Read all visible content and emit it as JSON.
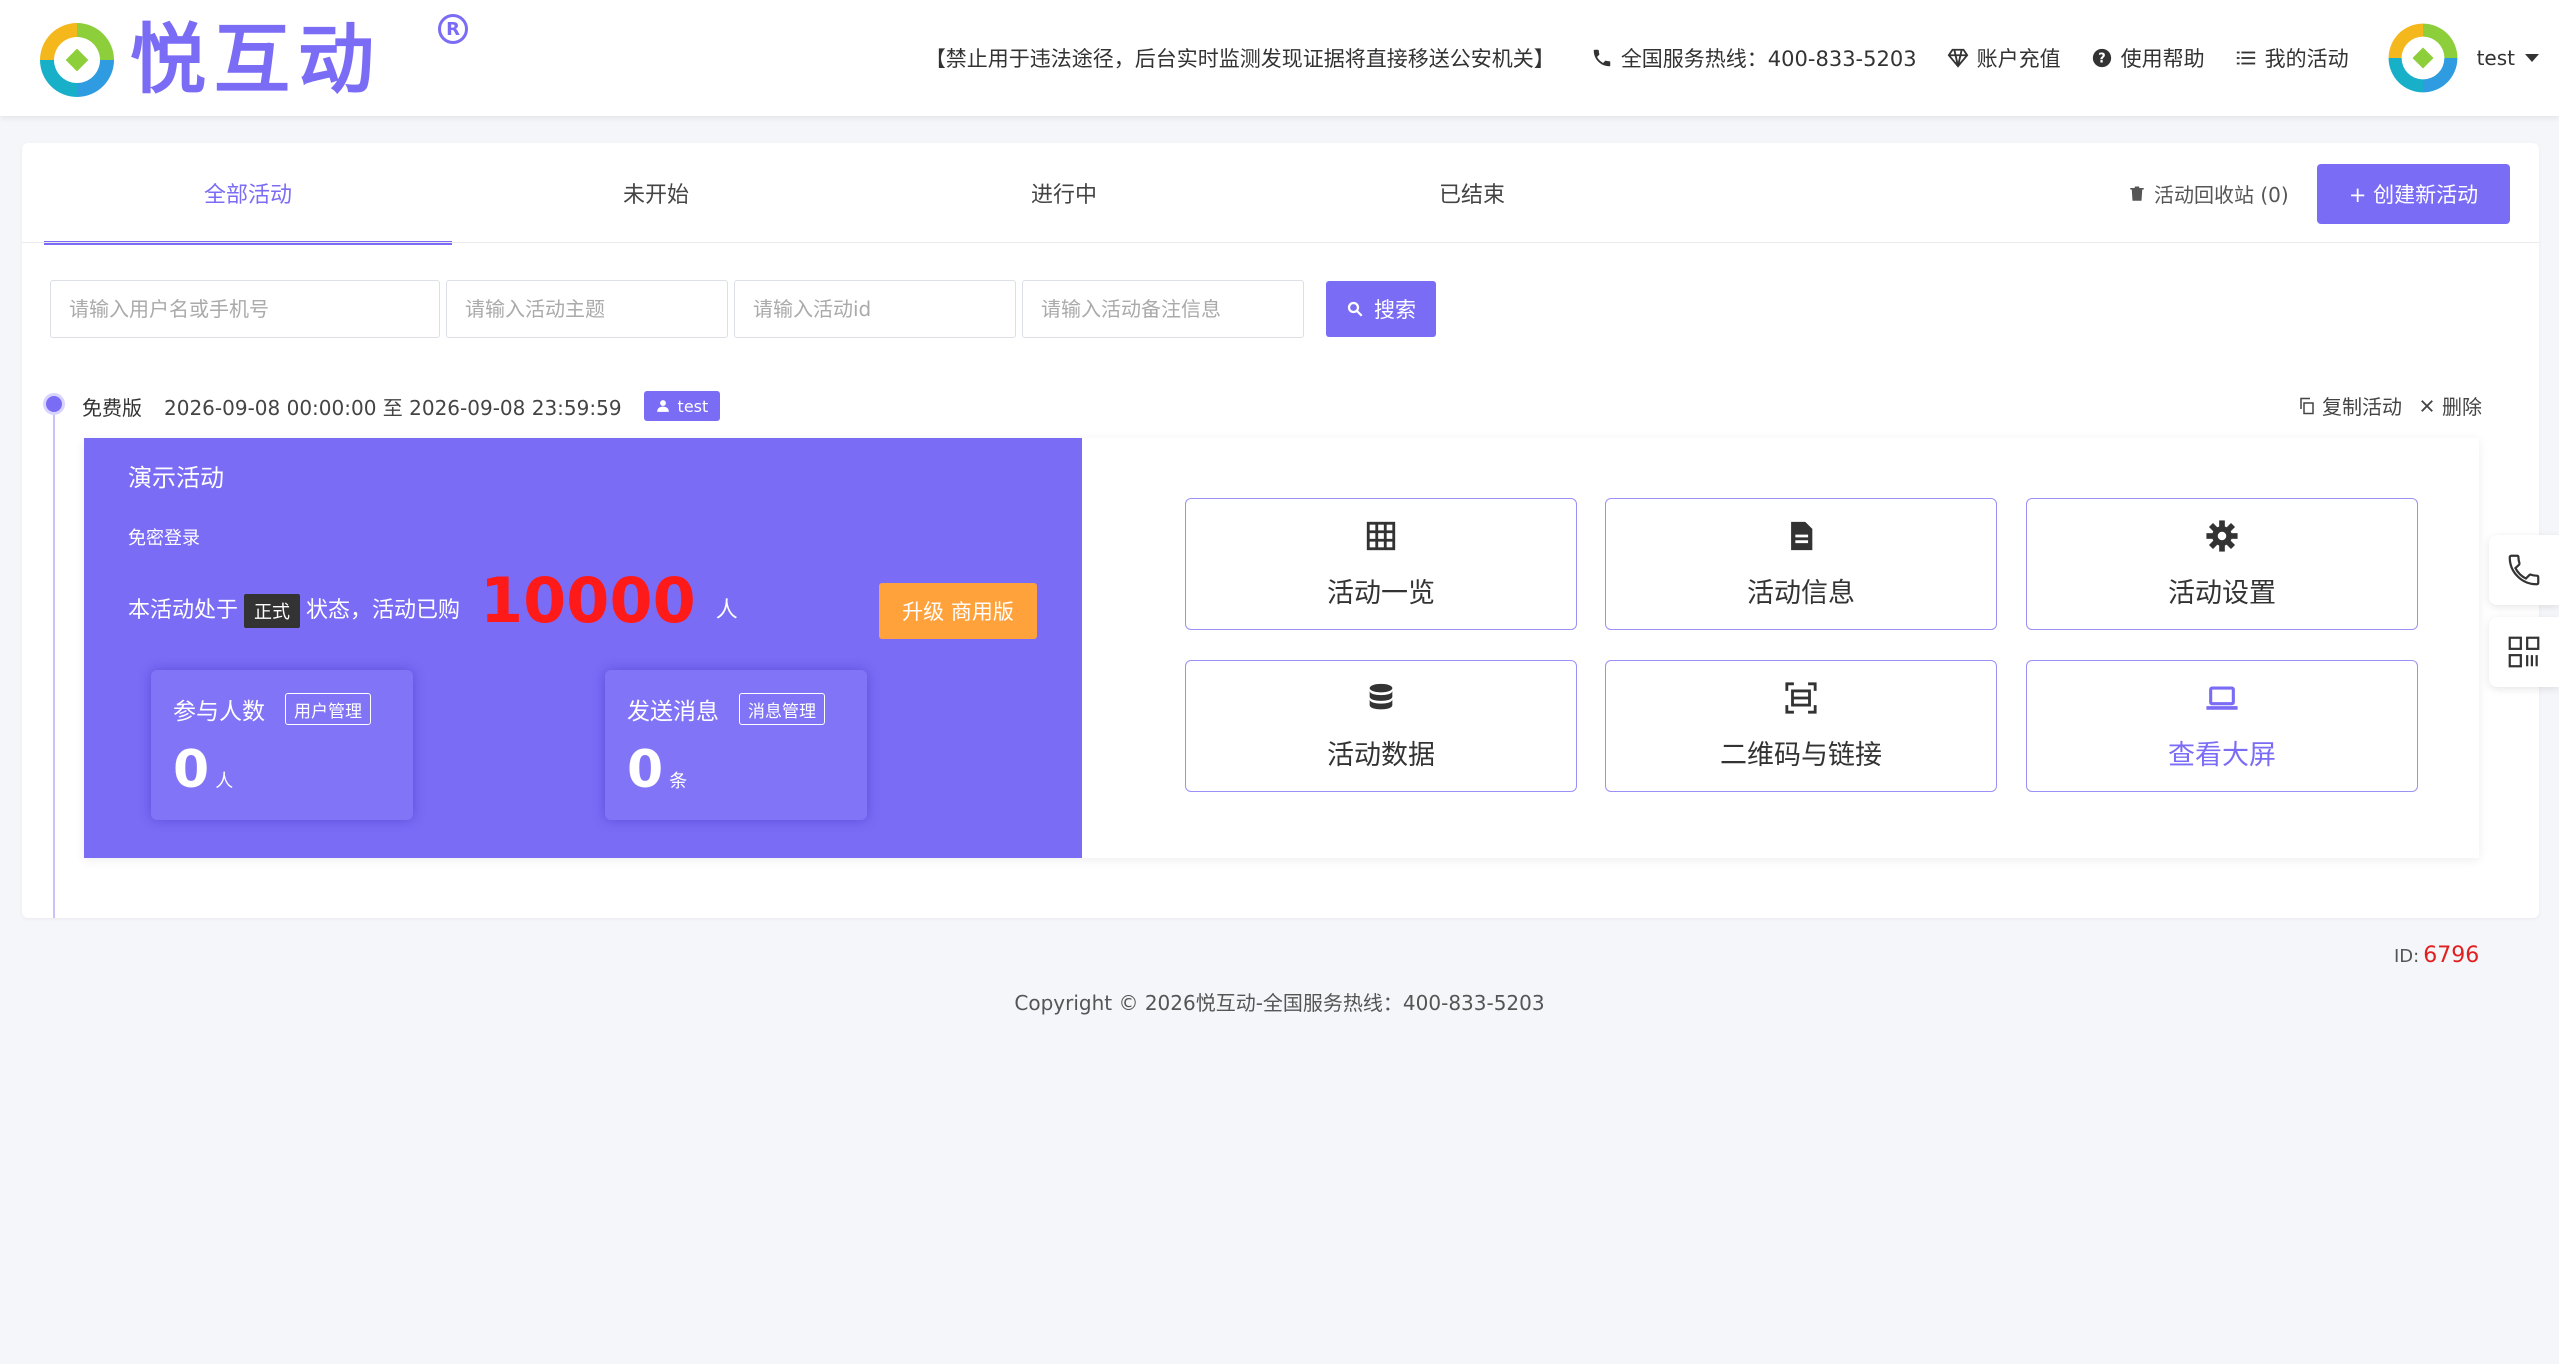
{
  "header": {
    "logo_text": "悦互动",
    "logo_reg": "R",
    "notice": "【禁止用于违法途径，后台实时监测发现证据将直接移送公安机关】",
    "hotline": "全国服务热线：400-833-5203",
    "recharge": "账户充值",
    "help": "使用帮助",
    "my_activities": "我的活动",
    "user": "test"
  },
  "tabs": [
    {
      "label": "全部活动",
      "active": true
    },
    {
      "label": "未开始"
    },
    {
      "label": "进行中"
    },
    {
      "label": "已结束"
    }
  ],
  "toolbar": {
    "recycle": "活动回收站 (0)",
    "create": "+ 创建新活动"
  },
  "search": {
    "user_placeholder": "请输入用户名或手机号",
    "topic_placeholder": "请输入活动主题",
    "id_placeholder": "请输入活动id",
    "remark_placeholder": "请输入活动备注信息",
    "button": "搜索"
  },
  "activity": {
    "version": "免费版",
    "time_range": "2026-09-08 00:00:00 至 2026-09-08 23:59:59",
    "user_tag": "test",
    "copy": "复制活动",
    "delete": "删除",
    "title": "演示活动",
    "login_mode": "免密登录",
    "status_prefix": "本活动处于",
    "status": "正式",
    "status_suffix": "状态，活动已购",
    "purchased": "10000",
    "purchased_unit": "人",
    "upgrade": "升级 商用版",
    "participants_label": "参与人数",
    "participants_link": "用户管理",
    "participants_value": "0",
    "participants_unit": "人",
    "messages_label": "发送消息",
    "messages_link": "消息管理",
    "messages_value": "0",
    "messages_unit": "条",
    "buttons": [
      "活动一览",
      "活动信息",
      "活动设置",
      "活动数据",
      "二维码与链接",
      "查看大屏"
    ],
    "id_label": "ID:",
    "id_value": "6796"
  },
  "footer": "Copyright © 2026悦互动-全国服务热线：400-833-5203",
  "colors": {
    "primary": "#7b6cf6",
    "upgrade": "#ffa23b",
    "alert": "#ff1a1a"
  }
}
